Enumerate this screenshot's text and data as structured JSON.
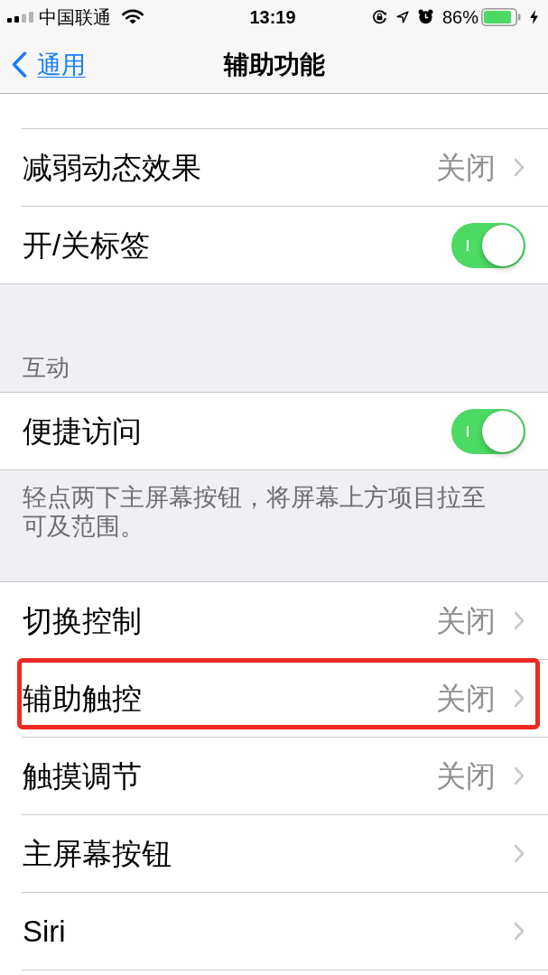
{
  "status_bar": {
    "carrier": "中国联通",
    "time": "13:19",
    "battery": "86%"
  },
  "nav_bar": {
    "back": "通用",
    "title": "辅助功能"
  },
  "sections": [
    {
      "rows": [
        {
          "kind": "link",
          "label": "减弱动态效果",
          "value": "关闭",
          "highlighted": false
        },
        {
          "kind": "toggle",
          "label": "开/关标签",
          "on": true,
          "highlighted": false
        }
      ]
    },
    {
      "header": "互动",
      "rows": [
        {
          "kind": "toggle",
          "label": "便捷访问",
          "on": true,
          "highlighted": false
        }
      ],
      "footer": "轻点两下主屏幕按钮，将屏幕上方项目拉至可及范围。"
    },
    {
      "rows": [
        {
          "kind": "link",
          "label": "切换控制",
          "value": "关闭",
          "highlighted": false
        },
        {
          "kind": "link",
          "label": "辅助触控",
          "value": "关闭",
          "highlighted": true
        },
        {
          "kind": "link",
          "label": "触摸调节",
          "value": "关闭",
          "highlighted": false
        },
        {
          "kind": "link",
          "label": "主屏幕按钮",
          "highlighted": false
        },
        {
          "kind": "link",
          "label": "Siri",
          "highlighted": false
        }
      ]
    }
  ]
}
